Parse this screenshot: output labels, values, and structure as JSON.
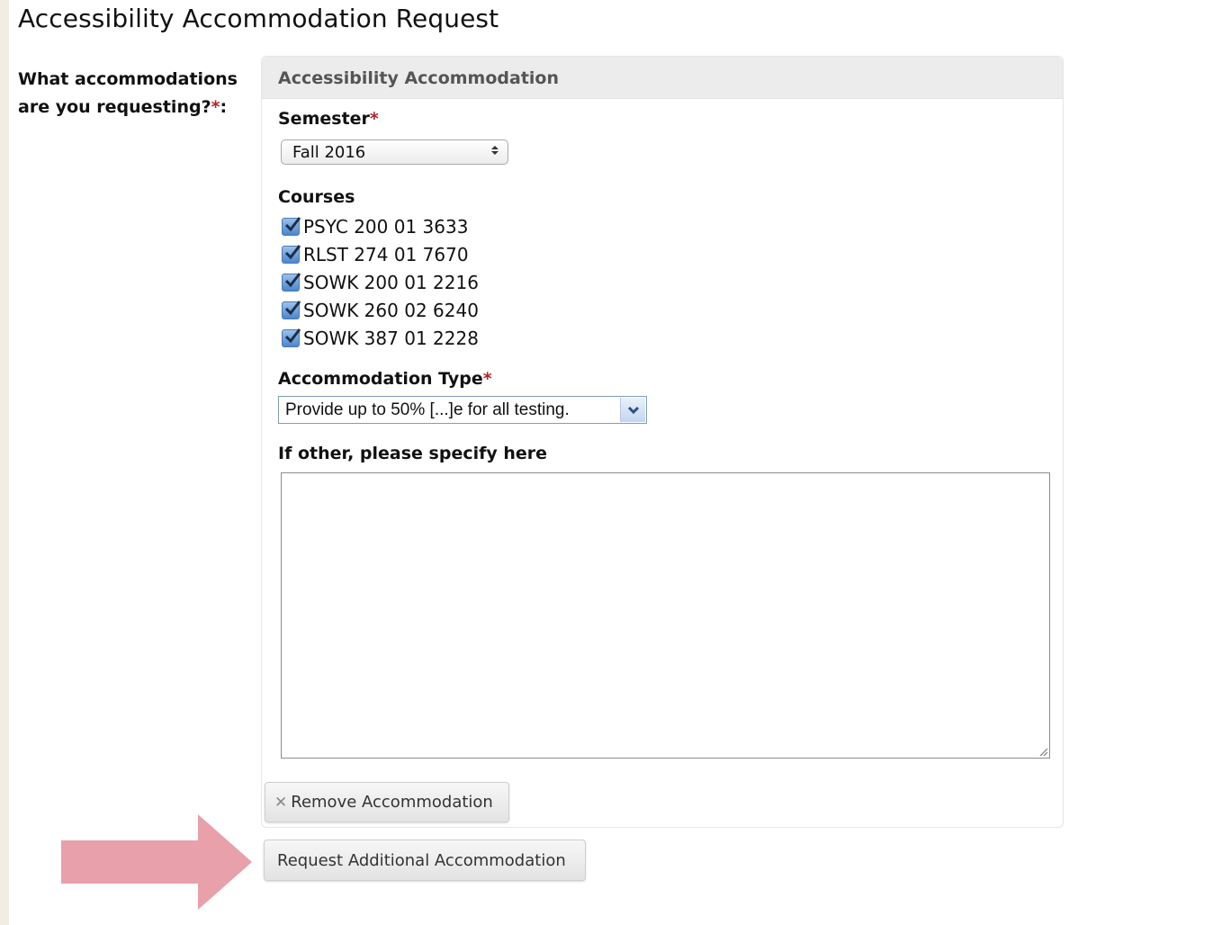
{
  "page": {
    "title": "Accessibility Accommodation Request"
  },
  "field": {
    "label": "What accommodations are you requesting?",
    "required_mark": "*",
    "colon": ":"
  },
  "accommodation": {
    "header": "Accessibility Accommodation",
    "semester_label": "Semester",
    "semester_value": "Fall 2016",
    "courses_label": "Courses",
    "courses": [
      {
        "label": "PSYC 200 01 3633",
        "checked": true
      },
      {
        "label": "RLST 274 01 7670",
        "checked": true
      },
      {
        "label": "SOWK 200 01 2216",
        "checked": true
      },
      {
        "label": "SOWK 260 02 6240",
        "checked": true
      },
      {
        "label": "SOWK 387 01 2228",
        "checked": true
      }
    ],
    "type_label": "Accommodation Type",
    "type_value": "Provide up to 50% [...]e for all testing.",
    "other_label": "If other, please specify here",
    "other_value": "",
    "remove_button": "Remove Accommodation"
  },
  "actions": {
    "request_additional": "Request Additional Accommodation"
  },
  "colors": {
    "required": "#b0232a",
    "arrow": "#e8a0aa",
    "checkbox": "#4a86cf"
  },
  "icons": [
    "close-icon",
    "checkmark-icon",
    "chevron-down-icon",
    "select-arrows-icon",
    "resize-grip-icon",
    "pointer-arrow"
  ]
}
